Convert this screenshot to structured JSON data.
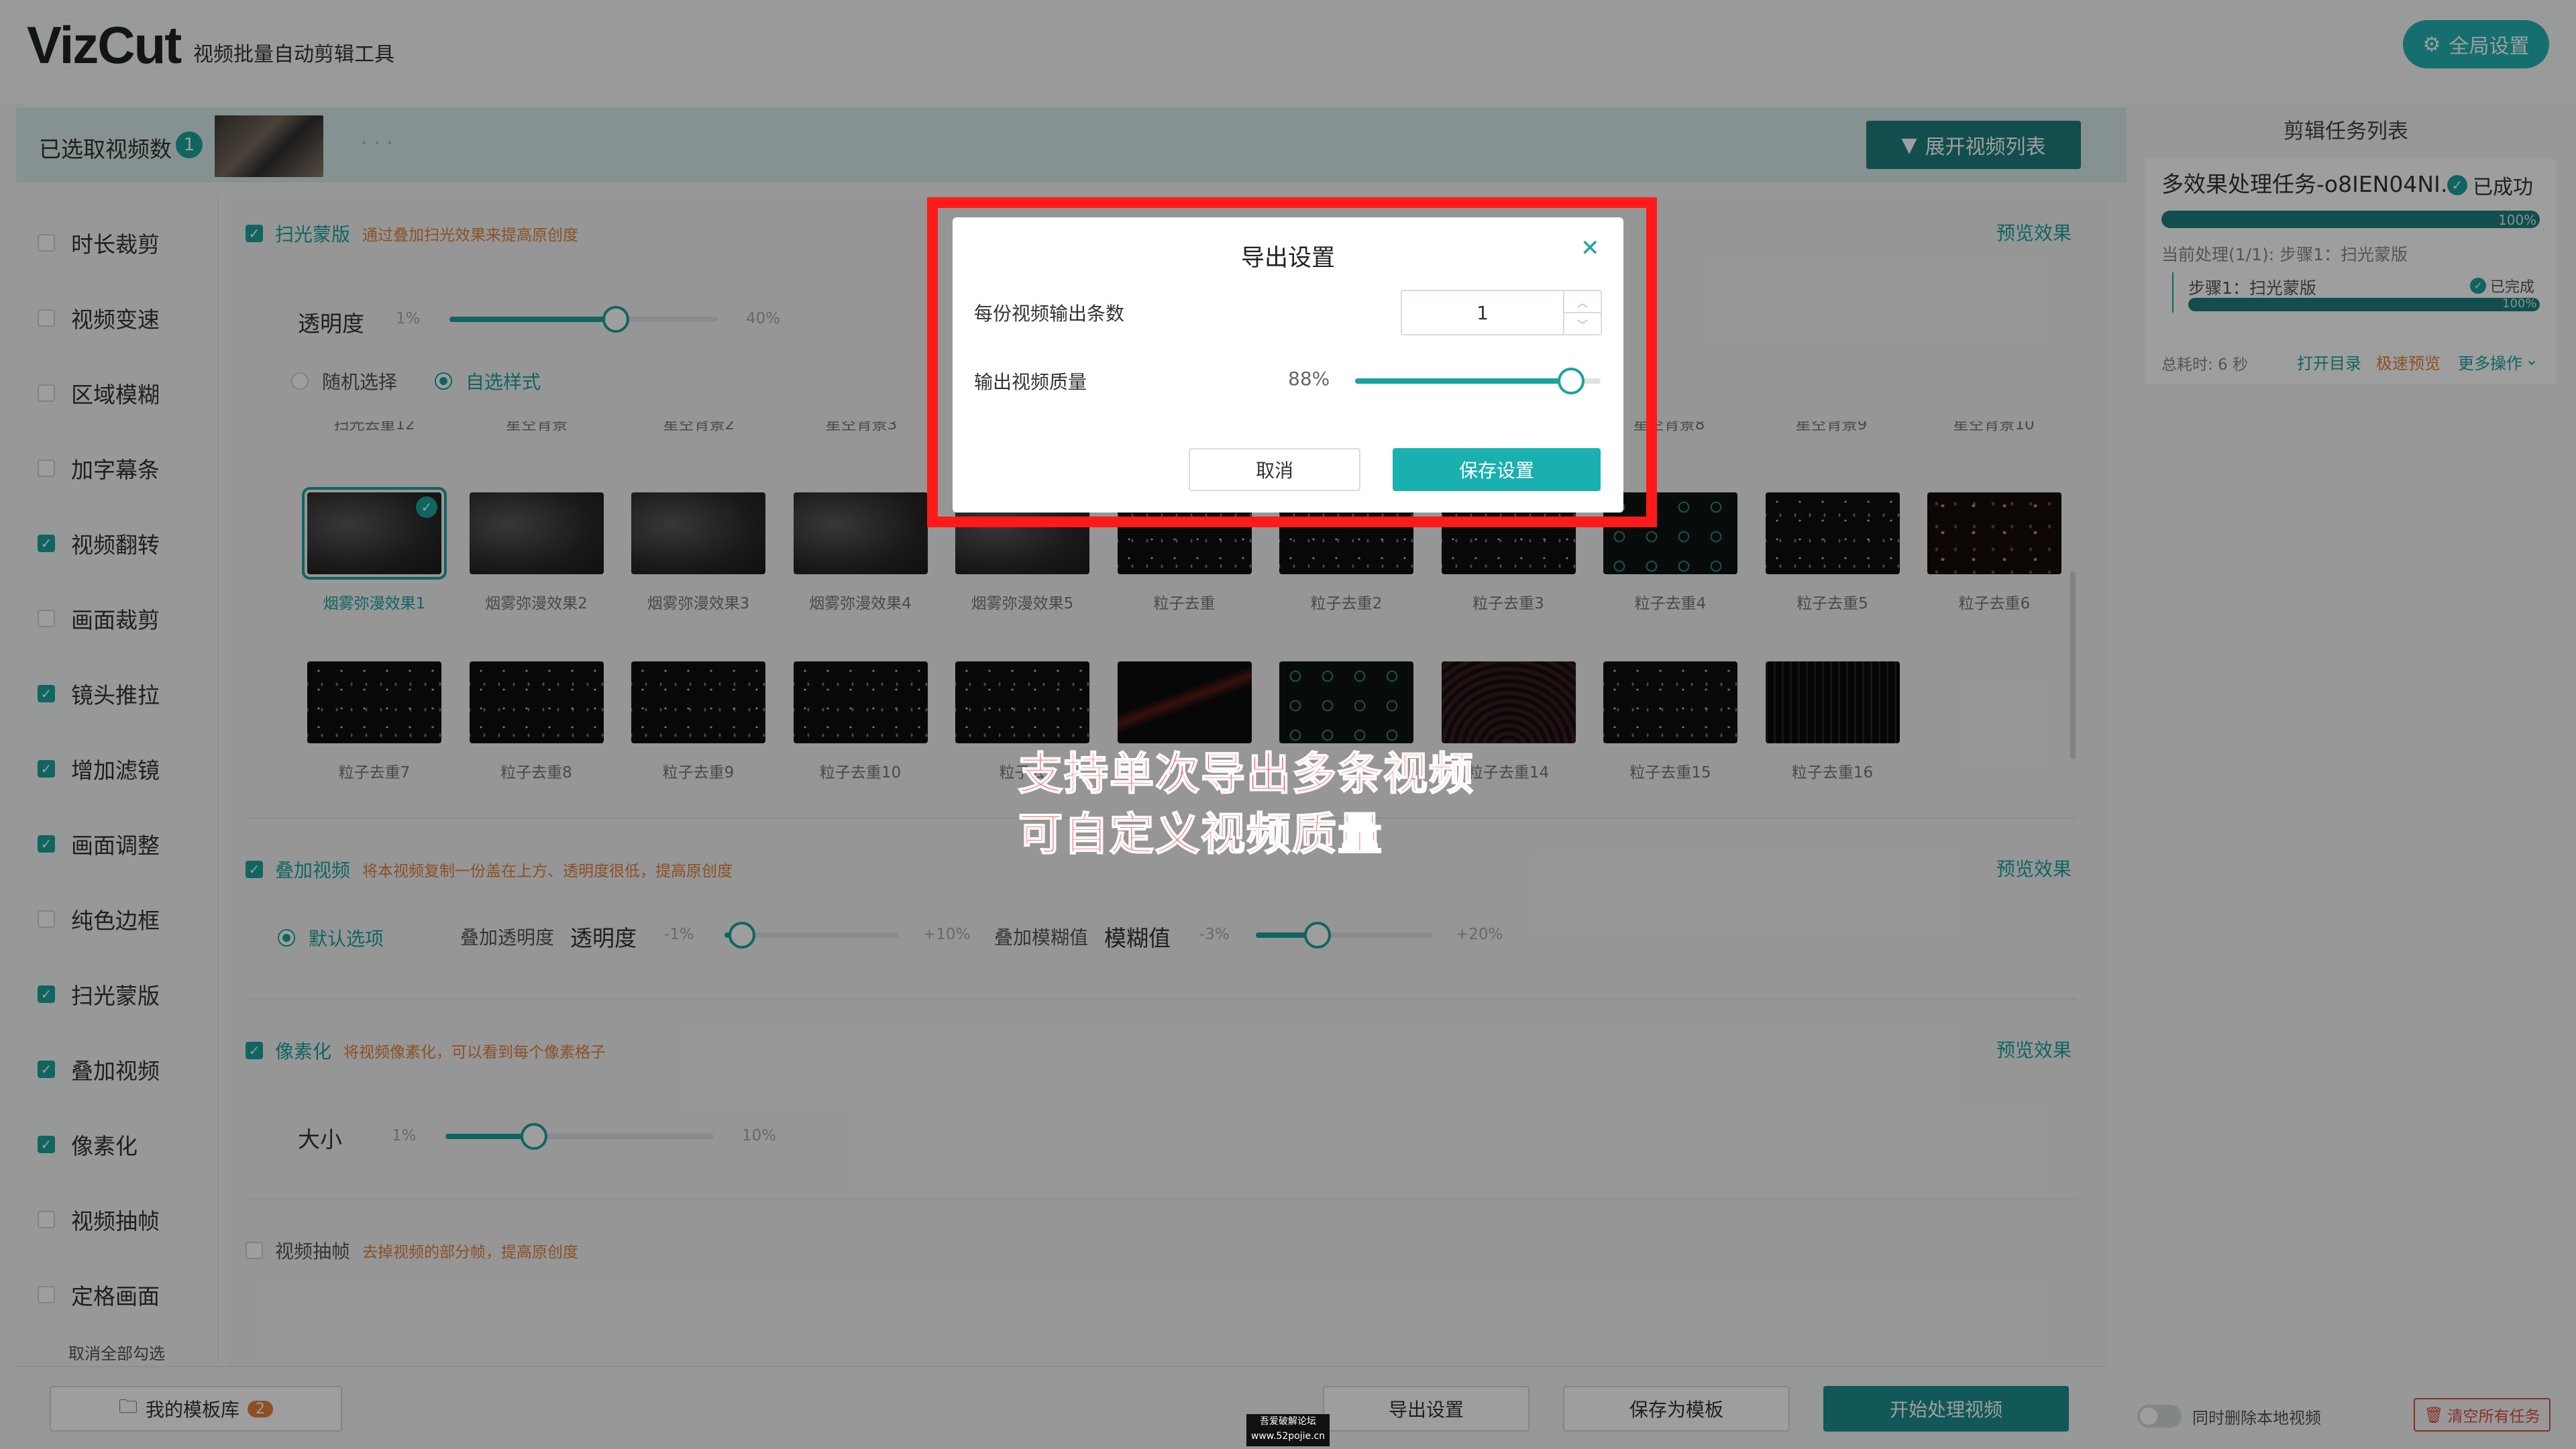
{
  "app": {
    "logo": "VizCut",
    "subtitle": "视频批量自动剪辑工具",
    "global_settings": "全局设置"
  },
  "selection": {
    "label": "已选取视频数",
    "count": "1",
    "more": "· · ·",
    "expand_button": "展开视频列表"
  },
  "sidebar": {
    "items": [
      {
        "label": "时长裁剪",
        "checked": false
      },
      {
        "label": "视频变速",
        "checked": false
      },
      {
        "label": "区域模糊",
        "checked": false
      },
      {
        "label": "加字幕条",
        "checked": false
      },
      {
        "label": "视频翻转",
        "checked": true
      },
      {
        "label": "画面裁剪",
        "checked": false
      },
      {
        "label": "镜头推拉",
        "checked": true
      },
      {
        "label": "增加滤镜",
        "checked": true
      },
      {
        "label": "画面调整",
        "checked": true
      },
      {
        "label": "纯色边框",
        "checked": false
      },
      {
        "label": "扫光蒙版",
        "checked": true
      },
      {
        "label": "叠加视频",
        "checked": true
      },
      {
        "label": "像素化",
        "checked": true
      },
      {
        "label": "视频抽帧",
        "checked": false
      },
      {
        "label": "定格画面",
        "checked": false
      }
    ],
    "deselect_all": "取消全部勾选"
  },
  "sections": {
    "sweep": {
      "title": "扫光蒙版",
      "desc": "通过叠加扫光效果来提高原创度",
      "preview": "预览效果",
      "opacity_label": "透明度",
      "opacity_min": "1%",
      "opacity_max": "40%",
      "opacity_value": 0.62,
      "radio_random": "随机选择",
      "radio_custom": "自选样式",
      "clipped_labels": [
        "扫光去重12",
        "星空背景",
        "星空背景2",
        "星空背景3",
        "星空背景8",
        "星空背景9",
        "星空背景10"
      ],
      "row1": [
        "烟雾弥漫效果1",
        "烟雾弥漫效果2",
        "烟雾弥漫效果3",
        "烟雾弥漫效果4",
        "烟雾弥漫效果5",
        "粒子去重",
        "粒子去重2",
        "粒子去重3",
        "粒子去重4",
        "粒子去重5",
        "粒子去重6"
      ],
      "row2": [
        "粒子去重7",
        "粒子去重8",
        "粒子去重9",
        "粒子去重10",
        "粒子去",
        "",
        "",
        "粒子去重14",
        "粒子去重15",
        "粒子去重16"
      ]
    },
    "overlay": {
      "title": "叠加视频",
      "desc": "将本视频复制一份盖在上方、透明度很低，提高原创度",
      "preview": "预览效果",
      "radio_default": "默认选项",
      "opacity_group": "叠加透明度",
      "opacity_label": "透明度",
      "opacity_min": "-1%",
      "opacity_max": "+10%",
      "opacity_value": 0.1,
      "blur_group": "叠加模糊值",
      "blur_label": "模糊值",
      "blur_min": "-3%",
      "blur_max": "+20%",
      "blur_value": 0.35
    },
    "pixelate": {
      "title": "像素化",
      "desc": "将视频像素化，可以看到每个像素格子",
      "preview": "预览效果",
      "size_label": "大小",
      "size_min": "1%",
      "size_max": "10%",
      "size_value": 0.33
    },
    "frames": {
      "title": "视频抽帧",
      "desc": "去掉视频的部分帧，提高原创度"
    }
  },
  "dialog": {
    "title": "导出设置",
    "count_label": "每份视频输出条数",
    "count_value": "1",
    "quality_label": "输出视频质量",
    "quality_text": "88%",
    "quality_value": 0.88,
    "cancel": "取消",
    "save": "保存设置"
  },
  "annotation": {
    "line1": "支持单次导出多条视频",
    "line2": "可自定义视频质量"
  },
  "task_panel": {
    "title": "剪辑任务列表",
    "task_name": "多效果处理任务-o8IEN04NI…",
    "status": "已成功",
    "progress_text": "100%",
    "progress_value": 1.0,
    "current": "当前处理(1/1): 步骤1：扫光蒙版",
    "step_name": "步骤1：扫光蒙版",
    "step_status": "已完成",
    "step_progress_text": "100%",
    "elapsed": "总耗时: 6 秒",
    "open_dir": "打开目录",
    "fast_preview": "极速预览",
    "more_ops": "更多操作"
  },
  "bottom": {
    "template_lib": "我的模板库",
    "template_count": "2",
    "export_settings": "导出设置",
    "save_template": "保存为模板",
    "start": "开始处理视频",
    "delete_local": "同时删除本地视频",
    "clear_tasks": "清空所有任务",
    "watermark_line1": "吾爱破解论坛",
    "watermark_line2": "www.52pojie.cn"
  },
  "colors": {
    "accent": "#1aa39c",
    "dark_accent": "#1d7f7f",
    "warning": "#e0823c",
    "annotation": "#ff1a1a"
  }
}
